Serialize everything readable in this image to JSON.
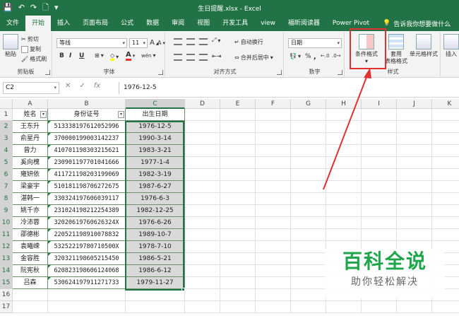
{
  "titlebar": {
    "filename": "生日提醒.xlsx",
    "separator": " - ",
    "app": "Excel"
  },
  "tabs": [
    "文件",
    "开始",
    "插入",
    "页面布局",
    "公式",
    "数据",
    "审阅",
    "视图",
    "开发工具",
    "view",
    "福昕阅读器",
    "Power Pivot"
  ],
  "active_tab": "开始",
  "tellme": "告诉我你想要做什么",
  "ribbon": {
    "clipboard": {
      "paste": "粘贴",
      "cut": "剪切",
      "copy": "复制",
      "format_painter": "格式刷",
      "label": "剪贴板"
    },
    "font": {
      "name": "等线",
      "size": "11",
      "grow": "A",
      "shrink": "A",
      "bold": "B",
      "italic": "I",
      "underline": "U",
      "font_color_glyph": "A",
      "wen": "wén",
      "label": "字体"
    },
    "alignment": {
      "wrap": "自动换行",
      "merge": "合并后居中",
      "label": "对齐方式"
    },
    "number": {
      "format": "日期",
      "percent": "%",
      "comma": ",",
      "label": "数字"
    },
    "styles": {
      "conditional": "条件格式",
      "table_line1": "套用",
      "table_line2": "表格格式",
      "cell_styles": "单元格样式",
      "label": "样式"
    },
    "cells": {
      "insert": "插入"
    }
  },
  "formula_bar": {
    "name_box": "C2",
    "cancel_glyph": "✕",
    "enter_glyph": "✓",
    "fx": "fx",
    "value": "1976-12-5"
  },
  "sheet": {
    "columns": [
      "A",
      "B",
      "C",
      "D",
      "E",
      "F",
      "G",
      "H",
      "I",
      "J",
      "K"
    ],
    "rows": [
      "1",
      "2",
      "3",
      "4",
      "5",
      "6",
      "7",
      "8",
      "9",
      "10",
      "11",
      "12",
      "13",
      "14",
      "15",
      "16",
      "17"
    ],
    "headers": [
      "姓名",
      "身份证号",
      "出生日期"
    ],
    "data": [
      [
        "王东升",
        "513338197612052996",
        "1976-12-5"
      ],
      [
        "俞星丹",
        "370000199003142237",
        "1990-3-14"
      ],
      [
        "曾力",
        "410701198303215621",
        "1983-3-21"
      ],
      [
        "奚向槐",
        "230901197701041666",
        "1977-1-4"
      ],
      [
        "雍妍依",
        "411721198203199069",
        "1982-3-19"
      ],
      [
        "梁豪宇",
        "510181198706272675",
        "1987-6-27"
      ],
      [
        "湛韩一",
        "330324197606039117",
        "1976-6-3"
      ],
      [
        "姚千亦",
        "231024198212254389",
        "1982-12-25"
      ],
      [
        "冷沛蓉",
        "32020619760626324X",
        "1976-6-26"
      ],
      [
        "邵德彬",
        "220521198910078832",
        "1989-10-7"
      ],
      [
        "袁曦嵘",
        "53252219780710500X",
        "1978-7-10"
      ],
      [
        "金容胜",
        "320321198605215450",
        "1986-5-21"
      ],
      [
        "阮宪秋",
        "620823198606124068",
        "1986-6-12"
      ],
      [
        "吕森",
        "530624197911271733",
        "1979-11-27"
      ]
    ]
  },
  "watermark": {
    "main": "百科全说",
    "sub": "助你轻松解决"
  },
  "colors": {
    "accent": "#217346",
    "callout": "#e03030",
    "watermark": "#1fa64b"
  }
}
